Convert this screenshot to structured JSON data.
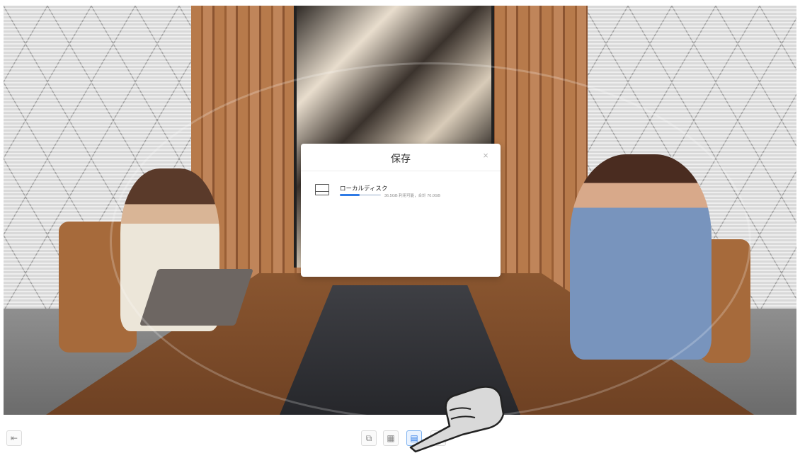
{
  "dialog": {
    "title": "保存",
    "close_label": "×",
    "disk": {
      "name": "ローカルディスク",
      "usage_text": "36.5GB 利用可能，合計 70.0GB",
      "used_fraction": 0.48,
      "icon": "hard-drive-icon"
    }
  },
  "toolbar": {
    "exit_icon": "exit-icon",
    "buttons": [
      {
        "name": "windows-button",
        "icon": "window-switch-icon",
        "glyph": "⧉"
      },
      {
        "name": "apps-button",
        "icon": "apps-grid-icon",
        "glyph": "▦"
      },
      {
        "name": "storage-button",
        "icon": "storage-icon",
        "glyph": "▤",
        "active": true
      },
      {
        "name": "refresh-button",
        "icon": "refresh-icon",
        "glyph": "↻"
      }
    ],
    "exit_glyph": "⇤"
  },
  "colors": {
    "accent": "#2f7be6",
    "dialog_bg": "#ffffff"
  }
}
